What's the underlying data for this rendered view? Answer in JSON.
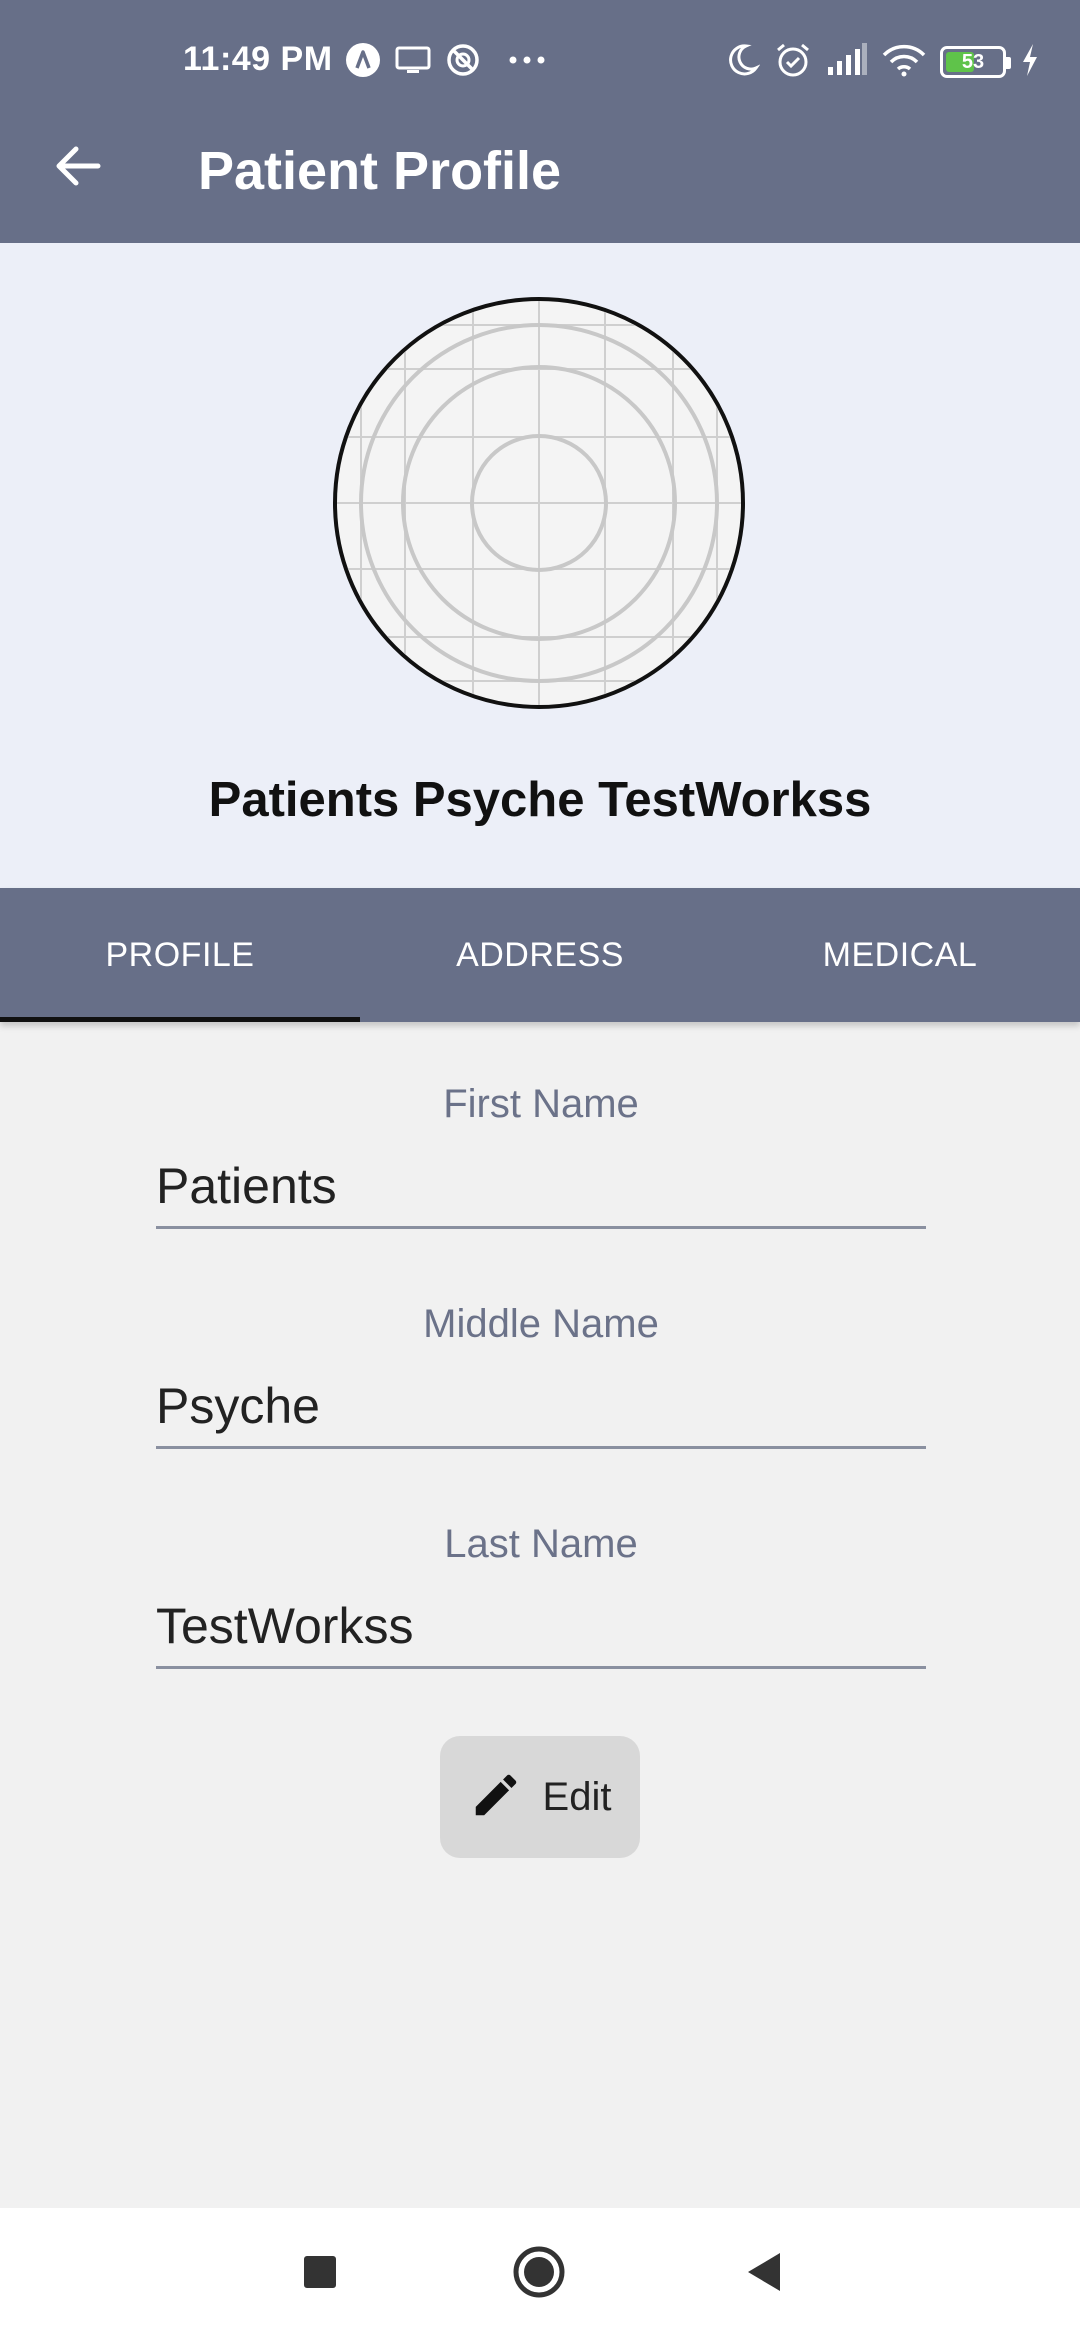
{
  "status_bar": {
    "time": "11:49 PM",
    "left_icons": [
      "app-notification-icon",
      "screen-cast-icon",
      "do-not-disturb-icon",
      "more-dots-icon"
    ],
    "right_icons": [
      "moon-icon",
      "alarm-icon",
      "signal-icon",
      "wifi-icon",
      "battery-icon",
      "charging-icon"
    ],
    "battery_level": "53"
  },
  "app_bar": {
    "title": "Patient Profile",
    "back_icon": "arrow-left-icon"
  },
  "profile": {
    "avatar_icon": "placeholder-avatar-icon",
    "full_name": "Patients Psyche TestWorkss"
  },
  "tabs": [
    {
      "label": "PROFILE",
      "active": true
    },
    {
      "label": "ADDRESS",
      "active": false
    },
    {
      "label": "MEDICAL",
      "active": false
    }
  ],
  "form": {
    "first_name": {
      "label": "First Name",
      "value": "Patients"
    },
    "middle_name": {
      "label": "Middle Name",
      "value": "Psyche"
    },
    "last_name": {
      "label": "Last Name",
      "value": "TestWorkss"
    }
  },
  "edit_button": {
    "label": "Edit",
    "icon": "pencil-icon"
  },
  "nav_bar": {
    "icons": [
      "recents-square-icon",
      "home-circle-icon",
      "back-triangle-icon"
    ]
  },
  "colors": {
    "app_bar": "#676f88",
    "header_bg": "#eceff8",
    "page_bg": "#f1f1f1",
    "label_text": "#6b7289",
    "battery_fill": "#5fc34a"
  }
}
